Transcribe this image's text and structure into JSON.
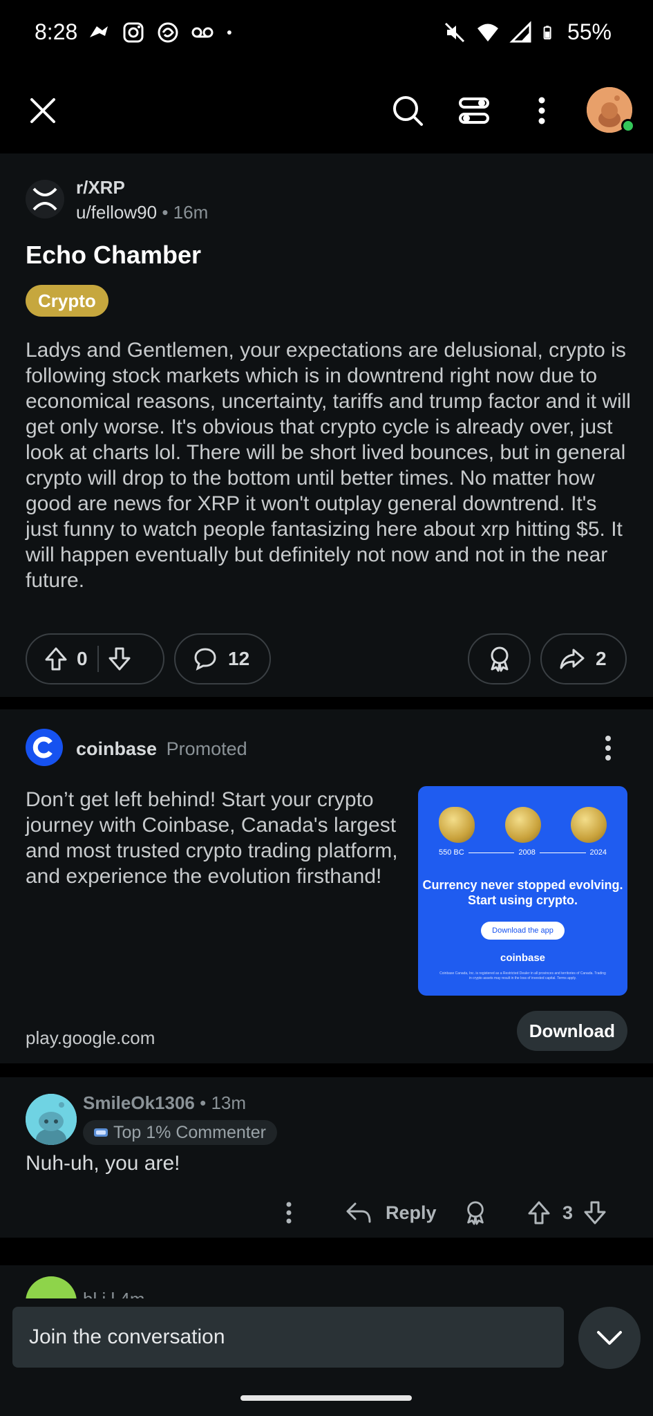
{
  "status_bar": {
    "time": "8:28",
    "battery": "55%",
    "left_icons": [
      "reddit-alien-icon",
      "instagram-icon",
      "swirl-app-icon",
      "voicemail-icon",
      "dot-icon"
    ],
    "right_icons": [
      "mute-icon",
      "wifi-icon",
      "signal-icon",
      "battery-icon"
    ]
  },
  "app_bar": {
    "icons": [
      "close-icon",
      "search-icon",
      "sort-filter-icon",
      "more-vertical-icon",
      "profile-avatar"
    ]
  },
  "post": {
    "subreddit": "r/XRP",
    "author": "u/fellow90",
    "separator": "•",
    "age": "16m",
    "title": "Echo Chamber",
    "flair": "Crypto",
    "body": "Ladys and Gentlemen, your expectations are delusional, crypto is following stock markets which is in downtrend right now due to economical reasons, uncertainty, tariffs and trump factor and it will get only worse. It's obvious that crypto cycle is already over, just look at charts lol. There will be short lived bounces, but in general crypto will drop to the bottom until better times. No matter how good are news for XRP it won't outplay general downtrend. It's just funny to watch people fantasizing here about xrp hitting $5. It will happen eventually but definitely not now and not in the near future.",
    "votes": "0",
    "comments": "12",
    "shares": "2"
  },
  "promoted": {
    "advertiser": "coinbase",
    "label": "Promoted",
    "text": "Don’t get left behind! Start your crypto journey with Coinbase, Canada's largest and most trusted crypto trading platform, and experience the evolution firsthand!",
    "image": {
      "years": [
        "550 BC",
        "2008",
        "2024"
      ],
      "headline": "Currency never stopped evolving. Start using crypto.",
      "button": "Download the app",
      "brand": "coinbase",
      "fine_print": "Coinbase Canada, Inc. is registered as a Restricted Dealer in all provinces and territories of Canada. Trading in crypto assets may result in the loss of invested capital. Terms apply."
    },
    "url": "play.google.com",
    "cta": "Download",
    "colors": {
      "brand_blue": "#1652f0"
    }
  },
  "comment": {
    "username": "SmileOk1306",
    "separator": "•",
    "age": "13m",
    "badge": "Top 1% Commenter",
    "body": "Nuh-uh, you are!",
    "reply_label": "Reply",
    "votes": "3"
  },
  "next_comment": {
    "username_partial": "bl   i   l   4m"
  },
  "composer": {
    "placeholder": "Join the conversation"
  },
  "colors": {
    "background": "#0e1113",
    "flair": "#c6a73e",
    "online": "#34c759"
  }
}
